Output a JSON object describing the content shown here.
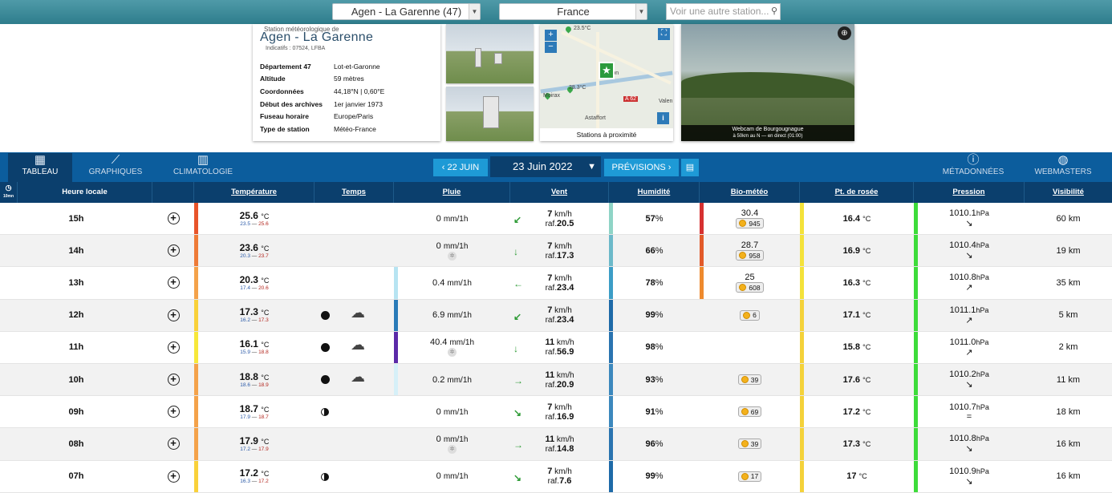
{
  "top": {
    "station_select": "Agen - La Garenne (47)",
    "country_select": "France",
    "search_placeholder": "Voir une autre station..."
  },
  "station": {
    "subtitle": "Station météorologique de",
    "name": "Agen - La Garenne",
    "indicatifs": "Indicatifs : 07524, LFBA",
    "details": [
      {
        "k": "Département 47",
        "v": "Lot-et-Garonne"
      },
      {
        "k": "Altitude",
        "v": "59 mètres"
      },
      {
        "k": "Coordonnées",
        "v": "44,18°N | 0,60°E"
      },
      {
        "k": "Début des archives",
        "v": "1er janvier 1973"
      },
      {
        "k": "Fuseau horaire",
        "v": "Europe/Paris"
      },
      {
        "k": "Type de station",
        "v": "Météo-France"
      }
    ]
  },
  "map": {
    "caption": "Stations à proximité",
    "labels": [
      "23.5°C",
      "28.3°C",
      "Astaffort",
      "A 62",
      "Valen",
      "ron",
      "Moirax"
    ]
  },
  "webcam": {
    "title": "Webcam de Bourgougnague",
    "sub": "à 50km au N — en direct (01:00)"
  },
  "nav": {
    "tableau": "TABLEAU",
    "graphiques": "GRAPHIQUES",
    "climatologie": "CLIMATOLOGIE",
    "prev_date": "22 JUIN",
    "current_date": "23 Juin 2022",
    "previsions": "PRÉVISIONS",
    "metadonnees": "MÉTADONNÉES",
    "webmasters": "WEBMASTERS"
  },
  "columns": {
    "heure": "Heure locale",
    "temperature": "Température",
    "temps": "Temps",
    "pluie": "Pluie",
    "vent": "Vent",
    "humidite": "Humidité",
    "biometeo": "Bio-météo",
    "rosee": "Pt. de rosée",
    "pression": "Pression",
    "visibilite": "Visibilité",
    "interval_label": "10mn"
  },
  "units": {
    "temp": "°C",
    "rain": "mm/1h",
    "wind": "km/h",
    "gust_prefix": "raf.",
    "hum": "%",
    "press": "hPa",
    "vis": "km"
  },
  "rows": [
    {
      "hour": "15h",
      "temp": "25.6",
      "tmin": "23.5",
      "tmax": "25.6",
      "weather": [],
      "rain": "0",
      "snow": false,
      "wind": "7",
      "gust": "20.5",
      "hum": "57",
      "bio": "30.4",
      "uv": "945",
      "dew": "16.4",
      "press": "1010.1",
      "ptrend": "↘",
      "vis": "60",
      "arrow": "↙"
    },
    {
      "hour": "14h",
      "temp": "23.6",
      "tmin": "20.3",
      "tmax": "23.7",
      "weather": [],
      "rain": "0",
      "snow": true,
      "wind": "7",
      "gust": "17.3",
      "hum": "66",
      "bio": "28.7",
      "uv": "958",
      "dew": "16.9",
      "press": "1010.4",
      "ptrend": "↘",
      "vis": "19",
      "arrow": "↓"
    },
    {
      "hour": "13h",
      "temp": "20.3",
      "tmin": "17.4",
      "tmax": "20.6",
      "weather": [],
      "rain": "0.4",
      "snow": false,
      "wind": "7",
      "gust": "23.4",
      "hum": "78",
      "bio": "25",
      "uv": "608",
      "dew": "16.3",
      "press": "1010.8",
      "ptrend": "↗",
      "vis": "35",
      "arrow": "←"
    },
    {
      "hour": "12h",
      "temp": "17.3",
      "tmin": "16.2",
      "tmax": "17.3",
      "weather": [
        "dot",
        "cloud"
      ],
      "rain": "6.9",
      "snow": false,
      "wind": "7",
      "gust": "23.4",
      "hum": "99",
      "bio": "",
      "uv": "6",
      "dew": "17.1",
      "press": "1011.1",
      "ptrend": "↗",
      "vis": "5",
      "arrow": "↙"
    },
    {
      "hour": "11h",
      "temp": "16.1",
      "tmin": "15.9",
      "tmax": "18.8",
      "weather": [
        "dot",
        "cloud"
      ],
      "rain": "40.4",
      "snow": true,
      "wind": "11",
      "gust": "56.9",
      "hum": "98",
      "bio": "",
      "uv": "",
      "dew": "15.8",
      "press": "1011.0",
      "ptrend": "↗",
      "vis": "2",
      "arrow": "↓"
    },
    {
      "hour": "10h",
      "temp": "18.8",
      "tmin": "18.6",
      "tmax": "18.9",
      "weather": [
        "dot",
        "cloud"
      ],
      "rain": "0.2",
      "snow": false,
      "wind": "11",
      "gust": "20.9",
      "hum": "93",
      "bio": "",
      "uv": "39",
      "dew": "17.6",
      "press": "1010.2",
      "ptrend": "↘",
      "vis": "11",
      "arrow": "→"
    },
    {
      "hour": "09h",
      "temp": "18.7",
      "tmin": "17.9",
      "tmax": "18.7",
      "weather": [
        "half"
      ],
      "rain": "0",
      "snow": false,
      "wind": "7",
      "gust": "16.9",
      "hum": "91",
      "bio": "",
      "uv": "69",
      "dew": "17.2",
      "press": "1010.7",
      "ptrend": "=",
      "vis": "18",
      "arrow": "↘"
    },
    {
      "hour": "08h",
      "temp": "17.9",
      "tmin": "17.2",
      "tmax": "17.9",
      "weather": [],
      "rain": "0",
      "snow": true,
      "wind": "11",
      "gust": "14.8",
      "hum": "96",
      "bio": "",
      "uv": "39",
      "dew": "17.3",
      "press": "1010.8",
      "ptrend": "↘",
      "vis": "16",
      "arrow": "→"
    },
    {
      "hour": "07h",
      "temp": "17.2",
      "tmin": "16.3",
      "tmax": "17.2",
      "weather": [
        "half"
      ],
      "rain": "0",
      "snow": false,
      "wind": "7",
      "gust": "7.6",
      "hum": "99",
      "bio": "",
      "uv": "17",
      "dew": "17",
      "press": "1010.9",
      "ptrend": "↘",
      "vis": "16",
      "arrow": "↘"
    }
  ],
  "colors": {
    "temp_bars": [
      "#e8542a",
      "#ee7b38",
      "#f4a24a",
      "#f9d13a",
      "#f7e83a",
      "#f4a24a",
      "#f4a24a",
      "#f4a24a",
      "#f9d13a"
    ],
    "rain_bars": [
      "",
      "",
      "#b7e4f2",
      "#2a7bb8",
      "#5b2aa8",
      "#d6f0f8",
      "",
      "",
      ""
    ],
    "wind_bars": [
      "#a9d9c2",
      "#86cbb0",
      "#5cb2a5",
      "#2d7bb0",
      "#ee9440",
      "#a9d9c2",
      "#6cc0a8",
      "#86cbb0",
      "#2a8cb8"
    ],
    "hum_bars": [
      "#8fd4c6",
      "#6cb9c9",
      "#3c9dc6",
      "#1e6aa8",
      "#2a74b0",
      "#3c88bd",
      "#3c88bd",
      "#2a74b0",
      "#1e6aa8"
    ],
    "bio_bars": [
      "#d63131",
      "#e25a2a",
      "#ee8a2e",
      "",
      "",
      "",
      "",
      "",
      ""
    ],
    "dew_bars": [
      "#f4e23a",
      "#f4e23a",
      "#f4e23a",
      "#f4d23a",
      "#f4d23a",
      "#f4d23a",
      "#f4d23a",
      "#f4d23a",
      "#f4d23a"
    ],
    "press_bars": [
      "#3ddc3a",
      "#3ddc3a",
      "#3ddc3a",
      "#3ddc3a",
      "#3ddc3a",
      "#3ddc3a",
      "#3ddc3a",
      "#3ddc3a",
      "#3ddc3a"
    ],
    "nav": "#0c5d9d",
    "header": "#0b3f6d",
    "accent": "#1e9ad6"
  }
}
